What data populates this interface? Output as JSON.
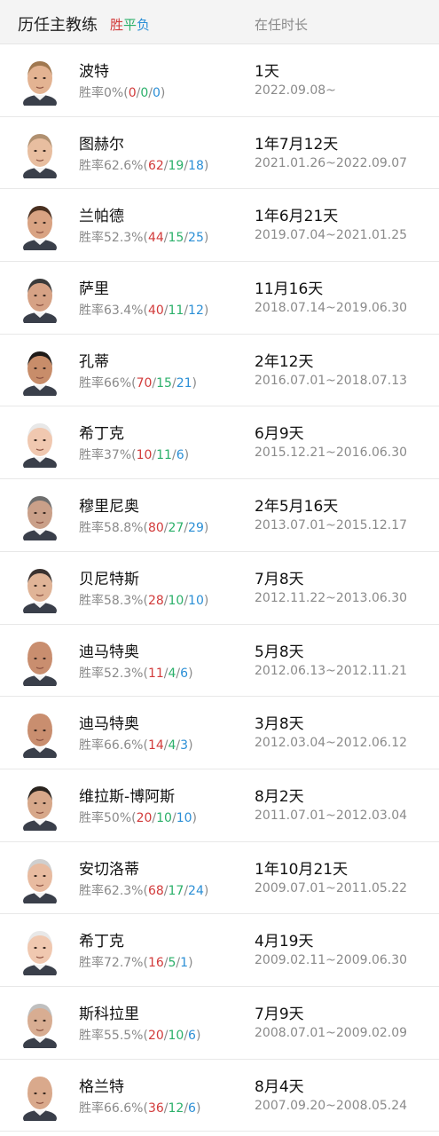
{
  "header": {
    "title": "历任主教练",
    "legend": {
      "win": "胜",
      "draw": "平",
      "loss": "负"
    },
    "tenure_header": "在任时长"
  },
  "colors": {
    "win": "#d23b3b",
    "draw": "#2bb06a",
    "loss": "#2b8fd6",
    "accent": "#2bb673"
  },
  "coaches": [
    {
      "name": "波特",
      "rate": "胜率0%",
      "w": "0",
      "d": "0",
      "l": "0",
      "tenure": "1天",
      "period": "2022.09.08~",
      "skin": "#e3b392",
      "hair": "#a07850"
    },
    {
      "name": "图赫尔",
      "rate": "胜率62.6%",
      "w": "62",
      "d": "19",
      "l": "18",
      "tenure": "1年7月12天",
      "period": "2021.01.26~2022.09.07",
      "skin": "#e8bea0",
      "hair": "#b09070"
    },
    {
      "name": "兰帕德",
      "rate": "胜率52.3%",
      "w": "44",
      "d": "15",
      "l": "25",
      "tenure": "1年6月21天",
      "period": "2019.07.04~2021.01.25",
      "skin": "#d9a383",
      "hair": "#4a3020"
    },
    {
      "name": "萨里",
      "rate": "胜率63.4%",
      "w": "40",
      "d": "11",
      "l": "12",
      "tenure": "11月16天",
      "period": "2018.07.14~2019.06.30",
      "skin": "#d6a285",
      "hair": "#3a3a3a"
    },
    {
      "name": "孔蒂",
      "rate": "胜率66%",
      "w": "70",
      "d": "15",
      "l": "21",
      "tenure": "2年12天",
      "period": "2016.07.01~2018.07.13",
      "skin": "#c88d6a",
      "hair": "#1e1a18"
    },
    {
      "name": "希丁克",
      "rate": "胜率37%",
      "w": "10",
      "d": "11",
      "l": "6",
      "tenure": "6月9天",
      "period": "2015.12.21~2016.06.30",
      "skin": "#f0c8b0",
      "hair": "#e8e8e8"
    },
    {
      "name": "穆里尼奥",
      "rate": "胜率58.8%",
      "w": "80",
      "d": "27",
      "l": "29",
      "tenure": "2年5月16天",
      "period": "2013.07.01~2015.12.17",
      "skin": "#caa089",
      "hair": "#6e6e6e"
    },
    {
      "name": "贝尼特斯",
      "rate": "胜率58.3%",
      "w": "28",
      "d": "10",
      "l": "10",
      "tenure": "7月8天",
      "period": "2012.11.22~2013.06.30",
      "skin": "#e0b497",
      "hair": "#3a3230"
    },
    {
      "name": "迪马特奥",
      "rate": "胜率52.3%",
      "w": "11",
      "d": "4",
      "l": "6",
      "tenure": "5月8天",
      "period": "2012.06.13~2012.11.21",
      "skin": "#c98e6f",
      "hair": "#c98e6f"
    },
    {
      "name": "迪马特奥",
      "rate": "胜率66.6%",
      "w": "14",
      "d": "4",
      "l": "3",
      "tenure": "3月8天",
      "period": "2012.03.04~2012.06.12",
      "skin": "#c98e6f",
      "hair": "#c98e6f"
    },
    {
      "name": "维拉斯-博阿斯",
      "rate": "胜率50%",
      "w": "20",
      "d": "10",
      "l": "10",
      "tenure": "8月2天",
      "period": "2011.07.01~2012.03.04",
      "skin": "#d7a88a",
      "hair": "#2a241f"
    },
    {
      "name": "安切洛蒂",
      "rate": "胜率62.3%",
      "w": "68",
      "d": "17",
      "l": "24",
      "tenure": "1年10月21天",
      "period": "2009.07.01~2011.05.22",
      "skin": "#e8bba0",
      "hair": "#cfcfcf"
    },
    {
      "name": "希丁克",
      "rate": "胜率72.7%",
      "w": "16",
      "d": "5",
      "l": "1",
      "tenure": "4月19天",
      "period": "2009.02.11~2009.06.30",
      "skin": "#f0c8b0",
      "hair": "#e8e8e8"
    },
    {
      "name": "斯科拉里",
      "rate": "胜率55.5%",
      "w": "20",
      "d": "10",
      "l": "6",
      "tenure": "7月9天",
      "period": "2008.07.01~2009.02.09",
      "skin": "#d8ad92",
      "hair": "#bfbfbf"
    },
    {
      "name": "格兰特",
      "rate": "胜率66.6%",
      "w": "36",
      "d": "12",
      "l": "6",
      "tenure": "8月4天",
      "period": "2007.09.20~2008.05.24",
      "skin": "#d9a98c",
      "hair": "#d9a98c"
    }
  ]
}
